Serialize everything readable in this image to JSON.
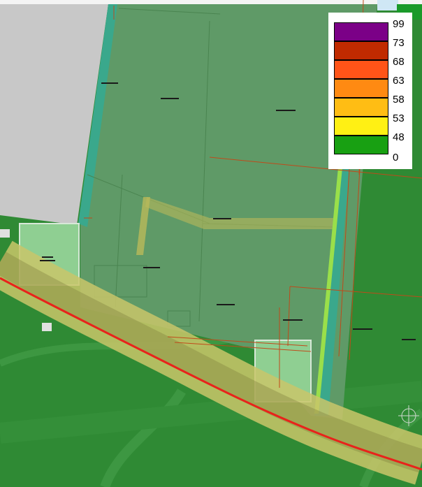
{
  "legend": {
    "classes": [
      {
        "label": "99",
        "color": "#7b0087"
      },
      {
        "label": "73",
        "color": "#c02a00"
      },
      {
        "label": "68",
        "color": "#ff5418"
      },
      {
        "label": "63",
        "color": "#ff8a12"
      },
      {
        "label": "58",
        "color": "#ffbd14"
      },
      {
        "label": "53",
        "color": "#fff014"
      },
      {
        "label": "48",
        "color": "#18a012"
      },
      {
        "label": "0",
        "color": ""
      }
    ]
  },
  "map": {
    "colors": {
      "background_field": "#2f8a34",
      "green_zone": "#5f9a67",
      "building_grey": "#c8c8c8",
      "road_buffer": "#c9c66a",
      "noise_line": "#e8231b",
      "canal": "#3aa88c",
      "parcel_line": "#c04a1a"
    }
  }
}
